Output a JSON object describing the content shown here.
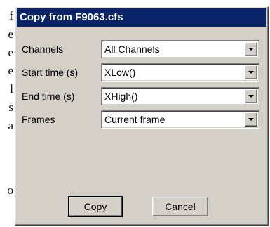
{
  "background_text": [
    "f",
    "e",
    "e",
    "e",
    "l",
    "s",
    "a",
    "",
    "",
    "",
    "o"
  ],
  "dialog": {
    "title": "Copy from F9063.cfs",
    "fields": [
      {
        "label": "Channels",
        "value": "All Channels"
      },
      {
        "label": "Start time (s)",
        "value": "XLow()"
      },
      {
        "label": "End time (s)",
        "value": "XHigh()"
      },
      {
        "label": "Frames",
        "value": "Current frame"
      }
    ],
    "buttons": {
      "copy": "Copy",
      "cancel": "Cancel"
    }
  },
  "colors": {
    "titlebar": "#0a246a",
    "face": "#d4d0c8"
  }
}
